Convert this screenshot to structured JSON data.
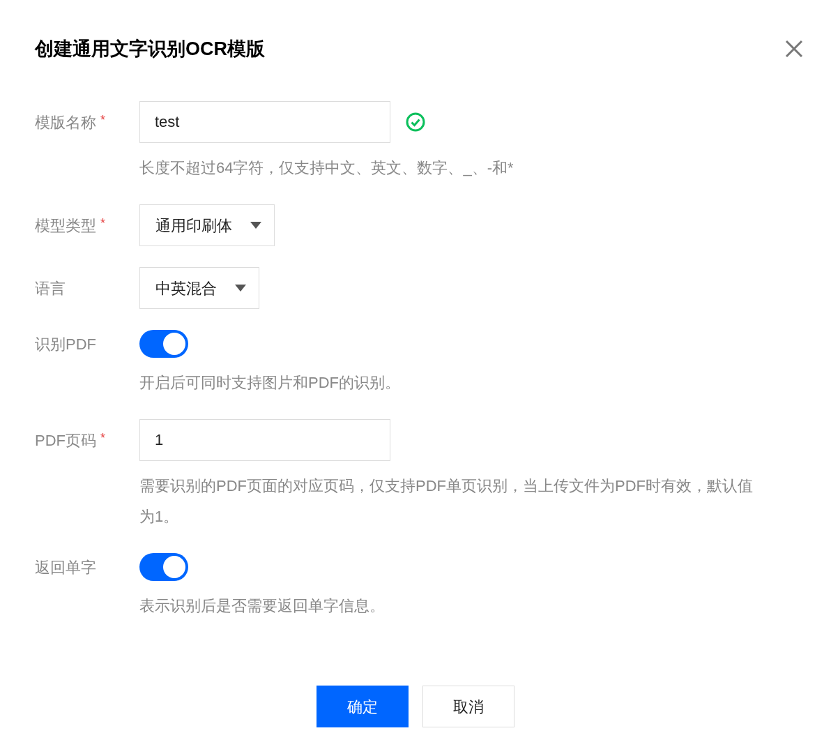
{
  "dialog": {
    "title": "创建通用文字识别OCR模版"
  },
  "fields": [
    {
      "kind": "text",
      "label": "模版名称",
      "required_mark": "*",
      "value": "test",
      "valid": true,
      "hint": "长度不超过64字符，仅支持中文、英文、数字、_、-和*"
    },
    {
      "kind": "select",
      "label": "模型类型",
      "required_mark": "*",
      "value": "通用印刷体"
    },
    {
      "kind": "select",
      "label": "语言",
      "value": "中英混合"
    },
    {
      "kind": "switch",
      "label": "识别PDF",
      "on": true,
      "hint": "开启后可同时支持图片和PDF的识别。"
    },
    {
      "kind": "text",
      "label": "PDF页码",
      "required_mark": "*",
      "value": "1",
      "hint": "需要识别的PDF页面的对应页码，仅支持PDF单页识别，当上传文件为PDF时有效，默认值为1。"
    },
    {
      "kind": "switch",
      "label": "返回单字",
      "on": true,
      "hint": "表示识别后是否需要返回单字信息。"
    }
  ],
  "buttons": [
    {
      "kind": "primary",
      "label": "确定"
    },
    {
      "kind": "default",
      "label": "取消"
    }
  ]
}
